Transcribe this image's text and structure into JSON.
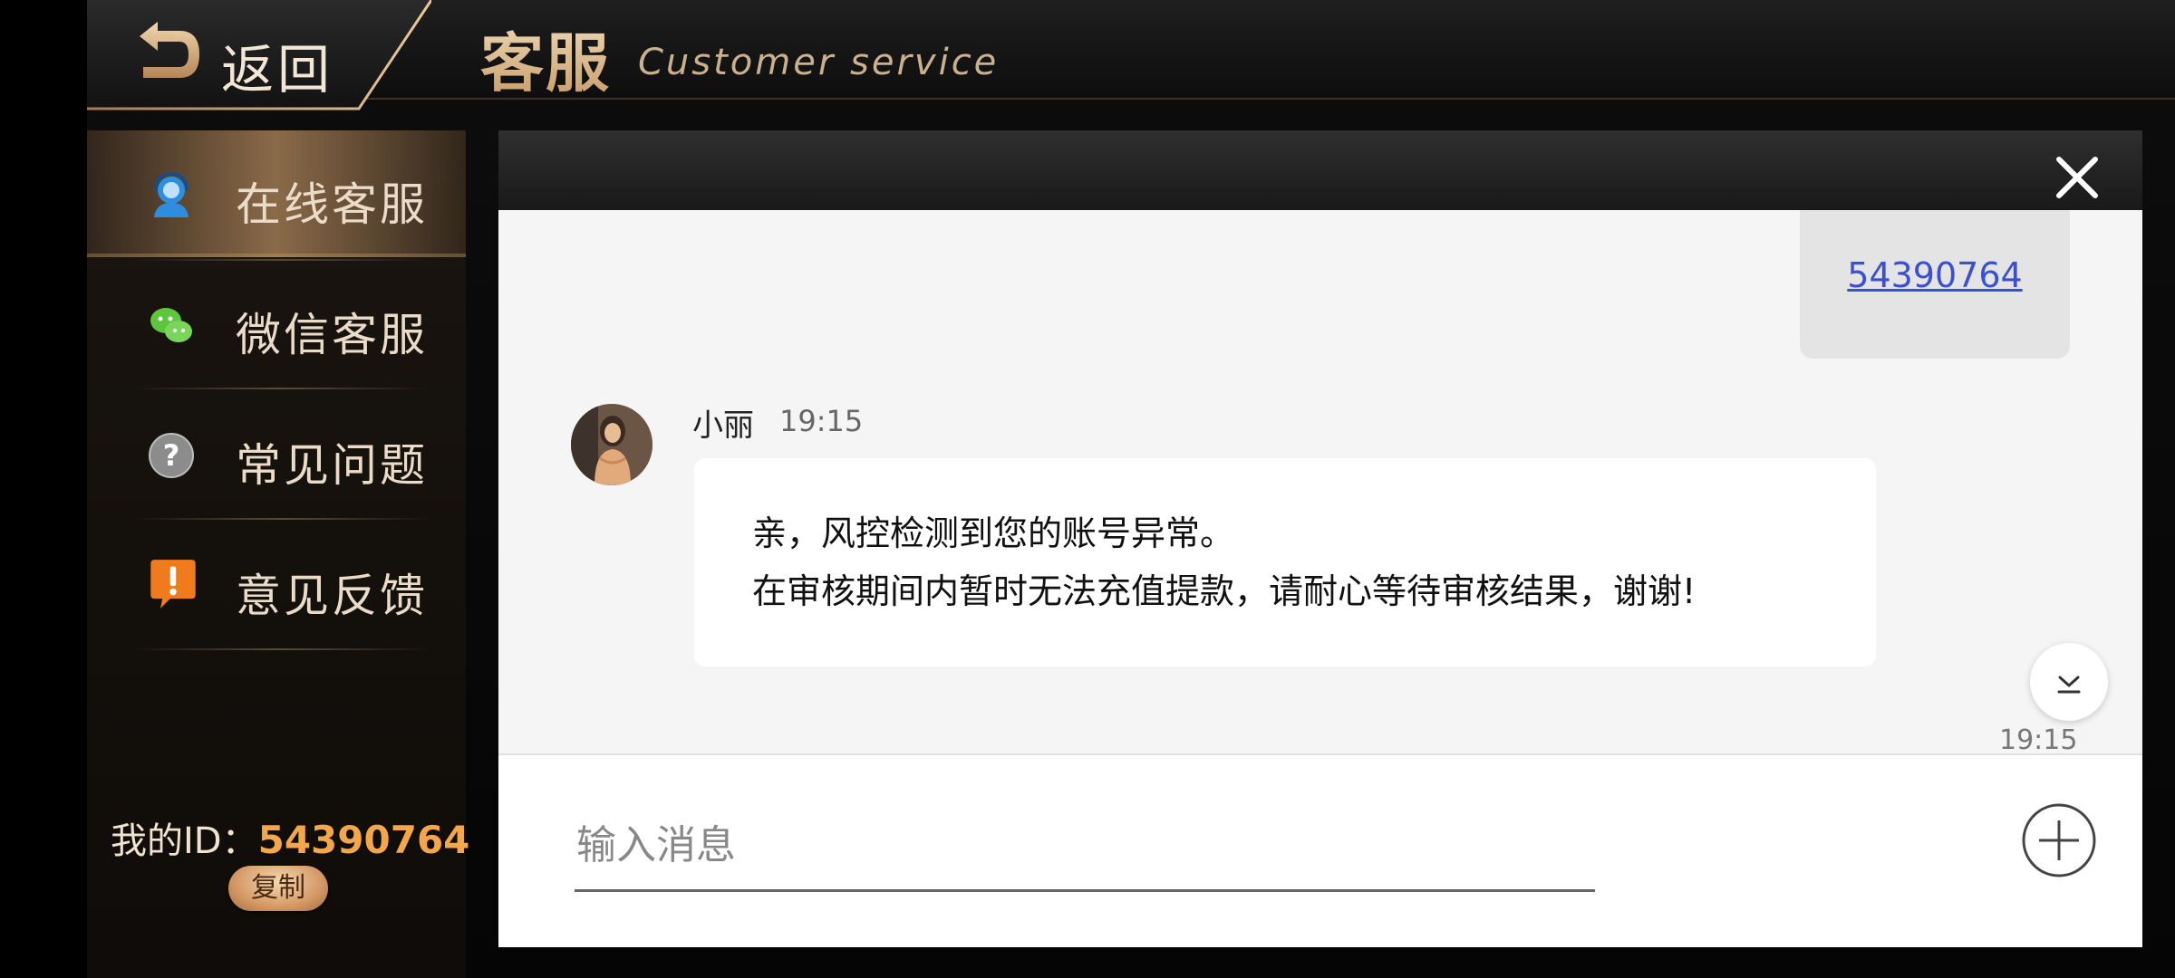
{
  "header": {
    "back_label": "返回",
    "title_cn": "客服",
    "title_en": "Customer service"
  },
  "sidebar": {
    "items": [
      {
        "label": "在线客服",
        "icon": "customer-service-icon",
        "active": true
      },
      {
        "label": "微信客服",
        "icon": "wechat-icon",
        "active": false
      },
      {
        "label": "常见问题",
        "icon": "question-icon",
        "active": false
      },
      {
        "label": "意见反馈",
        "icon": "feedback-icon",
        "active": false
      }
    ],
    "id_label": "我的ID：",
    "id_value": "54390764",
    "copy_label": "复制"
  },
  "chat": {
    "self_message": "54390764",
    "agent": {
      "name": "小丽",
      "time": "19:15",
      "lines": [
        "亲，风控检测到您的账号异常。",
        "在审核期间内暂时无法充值提款，请耐心等待审核结果，谢谢!"
      ]
    },
    "bottom_time": "19:15",
    "input_placeholder": "输入消息"
  },
  "colors": {
    "accent_gold": "#d9b98f",
    "id_orange": "#f3a64a",
    "link_blue": "#3b4fd1",
    "panel_bg": "#f5f5f5"
  }
}
